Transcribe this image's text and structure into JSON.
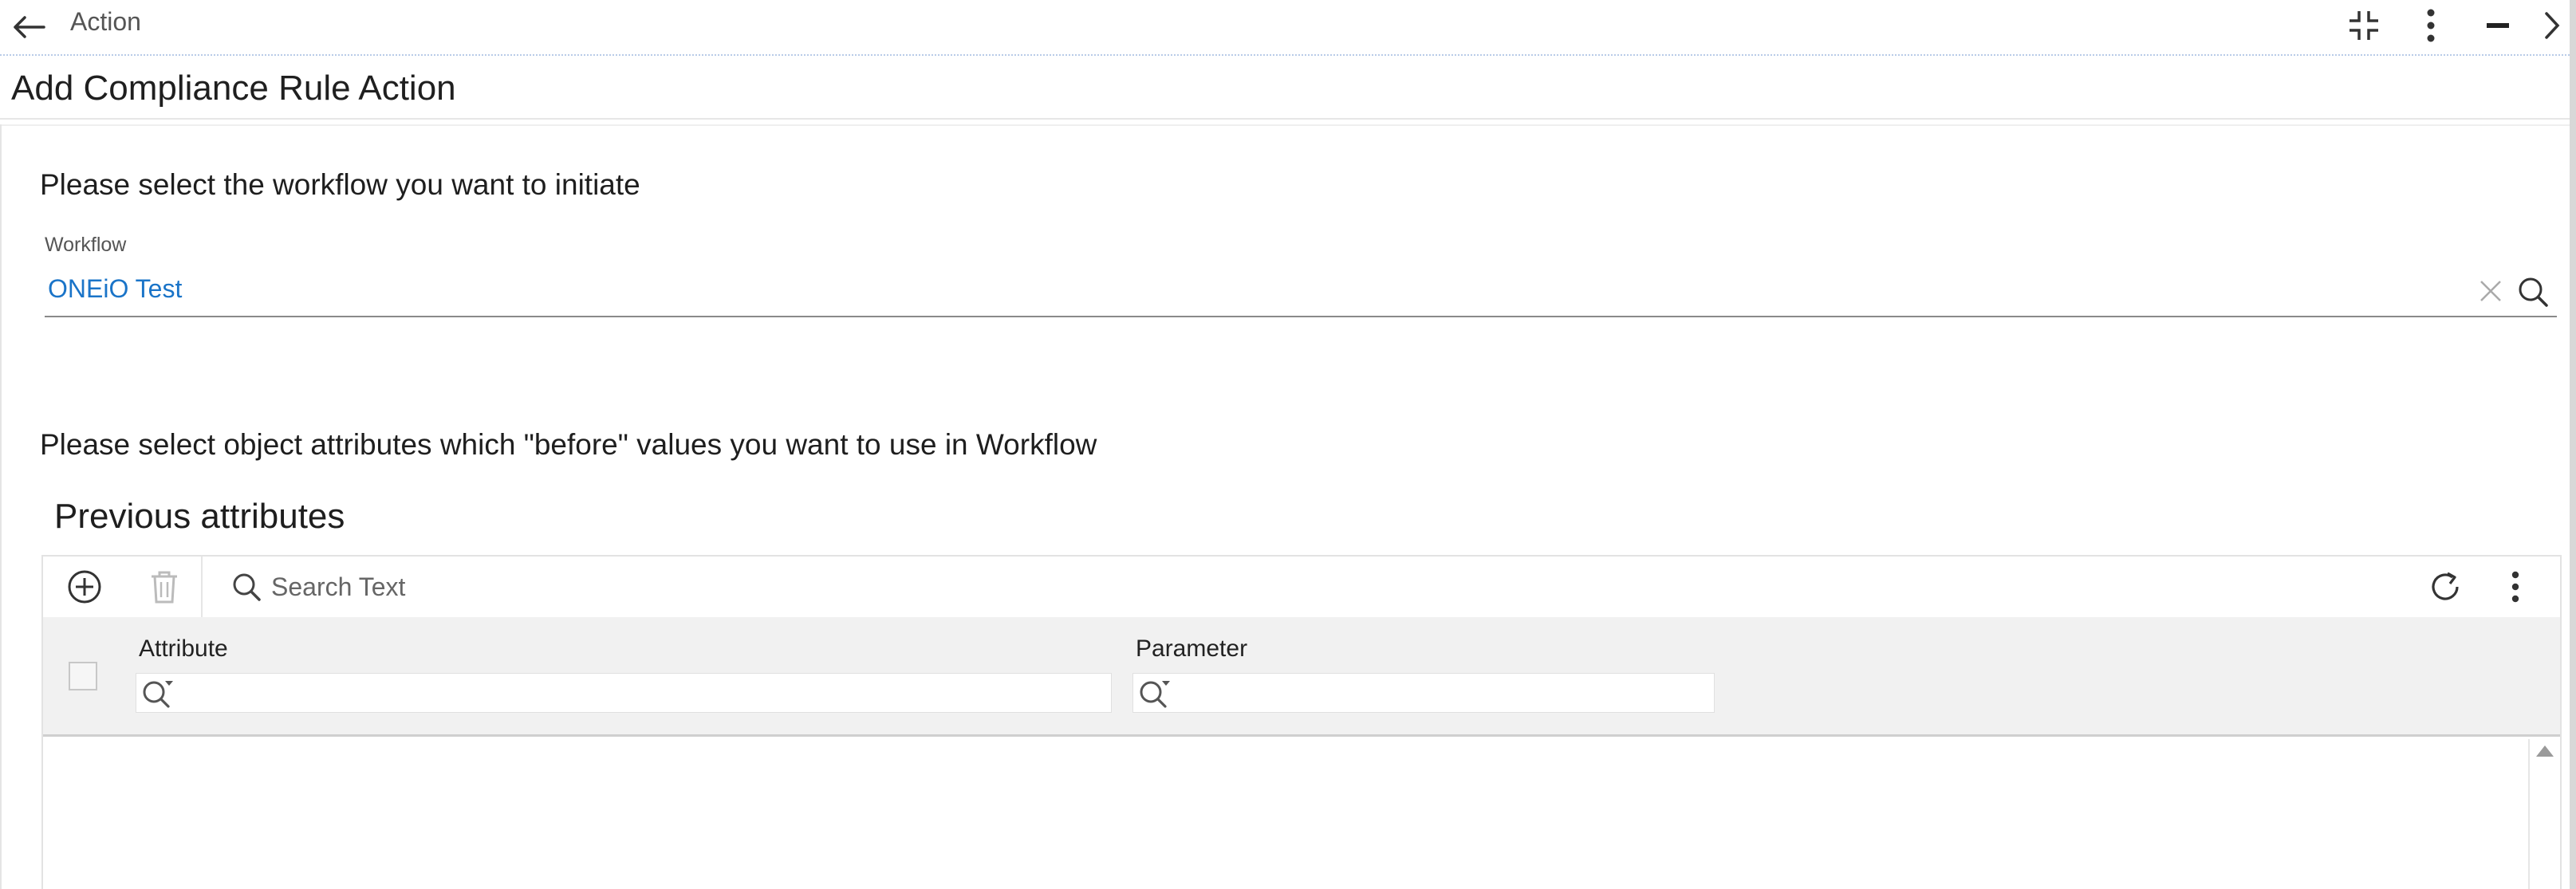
{
  "topbar": {
    "title": "Action",
    "icons": [
      "arrow-left-icon",
      "collapse-icon",
      "more-vertical-icon",
      "minimize-icon",
      "chevron-right-icon"
    ]
  },
  "page": {
    "title": "Add Compliance Rule Action"
  },
  "workflow_section": {
    "instruction": "Please select the workflow you want to initiate",
    "field_label": "Workflow",
    "field_value": "ONEiO Test"
  },
  "attributes_section": {
    "instruction": "Please select object attributes which \"before\" values you want to use in Workflow",
    "heading": "Previous attributes",
    "search_placeholder": "Search Text",
    "columns": [
      {
        "label": "Attribute"
      },
      {
        "label": "Parameter"
      }
    ],
    "rows": []
  },
  "colors": {
    "accent_blue": "#1a74c8",
    "header_bg": "#f1f1f1",
    "divider": "#e3e3e3"
  }
}
